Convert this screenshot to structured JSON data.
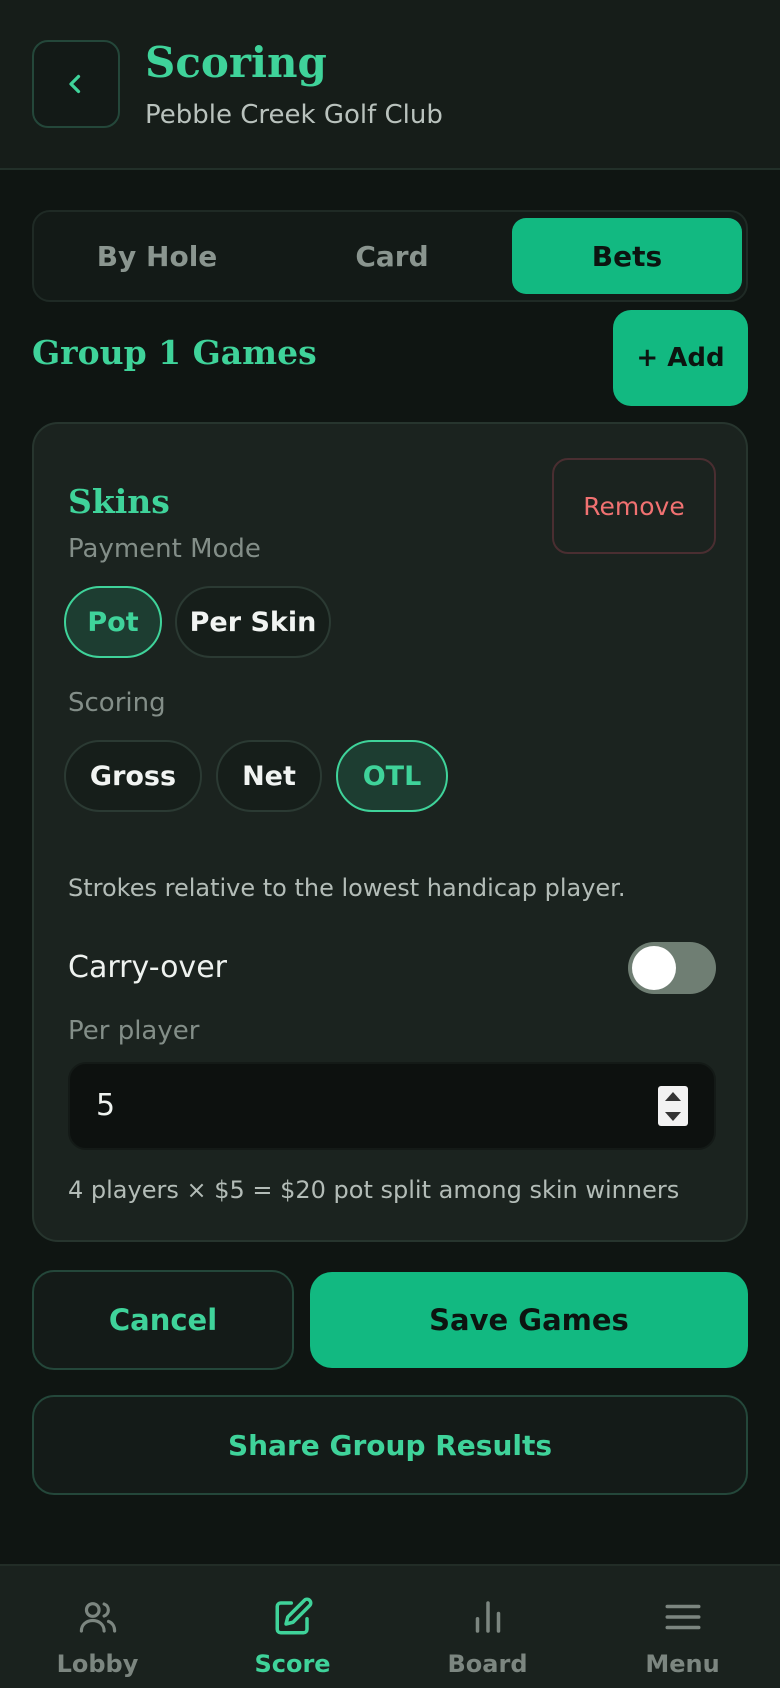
{
  "header": {
    "title": "Scoring",
    "subtitle": "Pebble Creek Golf Club",
    "back_icon": "chevron-left-icon"
  },
  "tabs": [
    {
      "label": "By Hole",
      "active": false
    },
    {
      "label": "Card",
      "active": false
    },
    {
      "label": "Bets",
      "active": true
    }
  ],
  "group": {
    "title": "Group 1 Games",
    "add_label": "+ Add"
  },
  "game_card": {
    "title": "Skins",
    "remove_label": "Remove",
    "payment_mode": {
      "label": "Payment Mode",
      "options": [
        {
          "label": "Pot",
          "selected": true
        },
        {
          "label": "Per Skin",
          "selected": false
        }
      ]
    },
    "scoring": {
      "label": "Scoring",
      "options": [
        {
          "label": "Gross",
          "selected": false
        },
        {
          "label": "Net",
          "selected": false
        },
        {
          "label": "OTL",
          "selected": true
        }
      ],
      "help": "Strokes relative to the lowest handicap player."
    },
    "carry_over": {
      "label": "Carry-over",
      "enabled": false
    },
    "per_player": {
      "label": "Per player",
      "value": "5"
    },
    "summary": "4 players × $5 = $20 pot split among skin winners"
  },
  "actions": {
    "cancel_label": "Cancel",
    "save_label": "Save Games",
    "share_label": "Share Group Results"
  },
  "nav": [
    {
      "label": "Lobby",
      "icon": "users-icon",
      "active": false
    },
    {
      "label": "Score",
      "icon": "edit-icon",
      "active": true
    },
    {
      "label": "Board",
      "icon": "bar-chart-icon",
      "active": false
    },
    {
      "label": "Menu",
      "icon": "menu-icon",
      "active": false
    }
  ],
  "colors": {
    "accent": "#12b981",
    "accent_text": "#3fd39a",
    "danger": "#f07171",
    "background": "#0f1512",
    "card": "#1b231f"
  }
}
